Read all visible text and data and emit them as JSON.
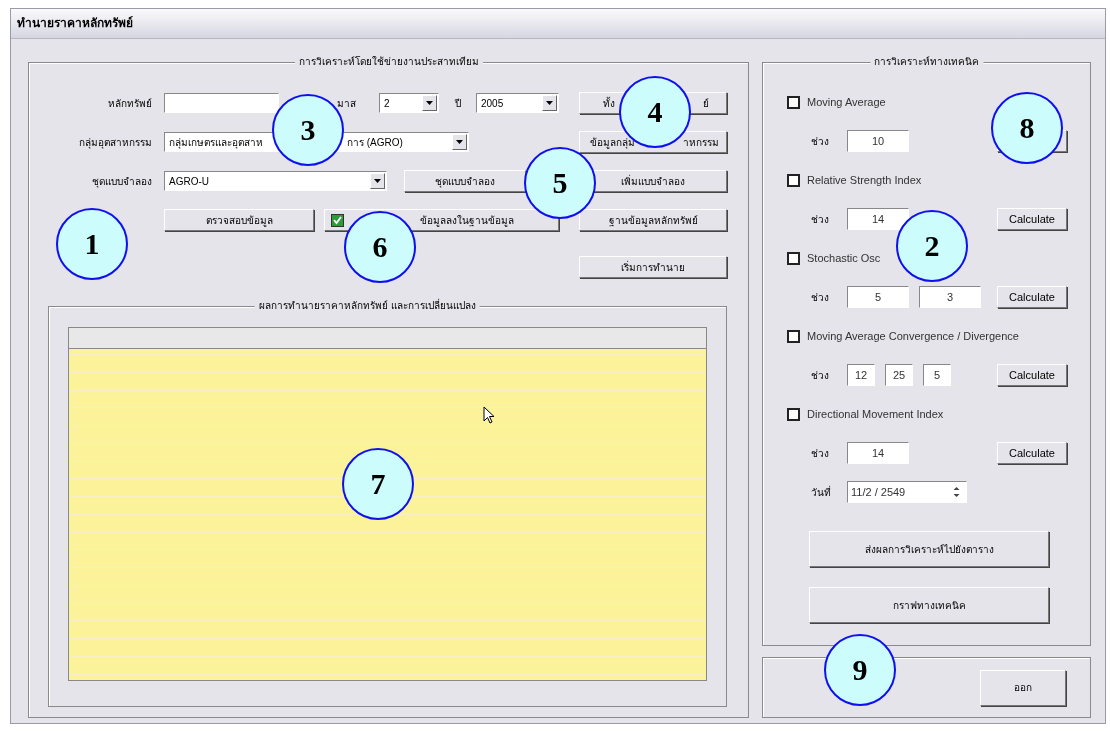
{
  "window": {
    "title": "ทำนายราคาหลักทรัพย์"
  },
  "neural_group": {
    "title": "การวิเคราะห์โดยใช้ข่ายงานประสาทเทียม",
    "security": {
      "label": "หลักทรัพย์"
    },
    "month": {
      "label": "มาส",
      "value": "2"
    },
    "year": {
      "label": "ปี",
      "value": "2005"
    },
    "industry": {
      "label": "กลุ่มอุตสาหกรรม",
      "value_parts": [
        "กลุ่มเกษตรและอุตสาห",
        "การ (AGRO)"
      ]
    },
    "model": {
      "label": "ชุดแบบจำลอง",
      "value": "AGRO-U"
    },
    "buttons": [
      {
        "kind": "fetch",
        "label_parts": [
          "ทั้ง",
          "ย์"
        ]
      },
      {
        "kind": "industry",
        "label_parts": [
          "ข้อมูลกลุ่ม",
          "าหกรรม"
        ]
      },
      {
        "kind": "model",
        "label_parts": [
          "ชุดแบบจำลอง"
        ]
      },
      {
        "kind": "add",
        "label_parts": [
          "เพิ่มแบบจำลอง"
        ]
      },
      {
        "kind": "check",
        "label_parts": [
          "ตรวจสอบข้อมูล"
        ]
      },
      {
        "kind": "database",
        "label_parts": [
          "ฐานข้อมูลหลักทรัพย์"
        ]
      },
      {
        "kind": "predict",
        "label_parts": [
          "เริ่มการทำนาย"
        ]
      }
    ],
    "save_option": {
      "label": "ข้อมูลลงในฐานข้อมูล",
      "checked": true
    }
  },
  "results_group": {
    "title": "ผลการทำนายราคาหลักทรัพย์ และการเปลี่ยนแปลง"
  },
  "technical_group": {
    "title": "การวิเคราะห์ทางเทคนิค",
    "indicators": [
      {
        "name": "Moving Average",
        "checked": false,
        "period_label": "ช่วง",
        "periods": [
          "10"
        ]
      },
      {
        "name": "Relative Strength Index",
        "checked": false,
        "period_label": "ช่วง",
        "periods": [
          "14"
        ],
        "button": "Calculate"
      },
      {
        "name": "Stochastic Osc",
        "checked": false,
        "period_label": "ช่วง",
        "periods": [
          "5",
          "3"
        ],
        "button": "Calculate"
      },
      {
        "name": "Moving Average Convergence / Divergence",
        "checked": false,
        "period_label": "ช่วง",
        "periods": [
          "12",
          "25",
          "5"
        ],
        "button": "Calculate"
      },
      {
        "name": "Directional Movement Index",
        "checked": false,
        "period_label": "ช่วง",
        "periods": [
          "14"
        ],
        "button": "Calculate"
      }
    ],
    "date": {
      "label": "วันที่",
      "value": "11/2 / 2549"
    },
    "buttons": [
      "ส่งผลการวิเคราะห์ไปยังตาราง",
      "กราฟทางเทคนิค"
    ]
  },
  "exit_button": "ออก",
  "callouts": [
    "1",
    "2",
    "3",
    "4",
    "5",
    "6",
    "7",
    "8",
    "9"
  ]
}
